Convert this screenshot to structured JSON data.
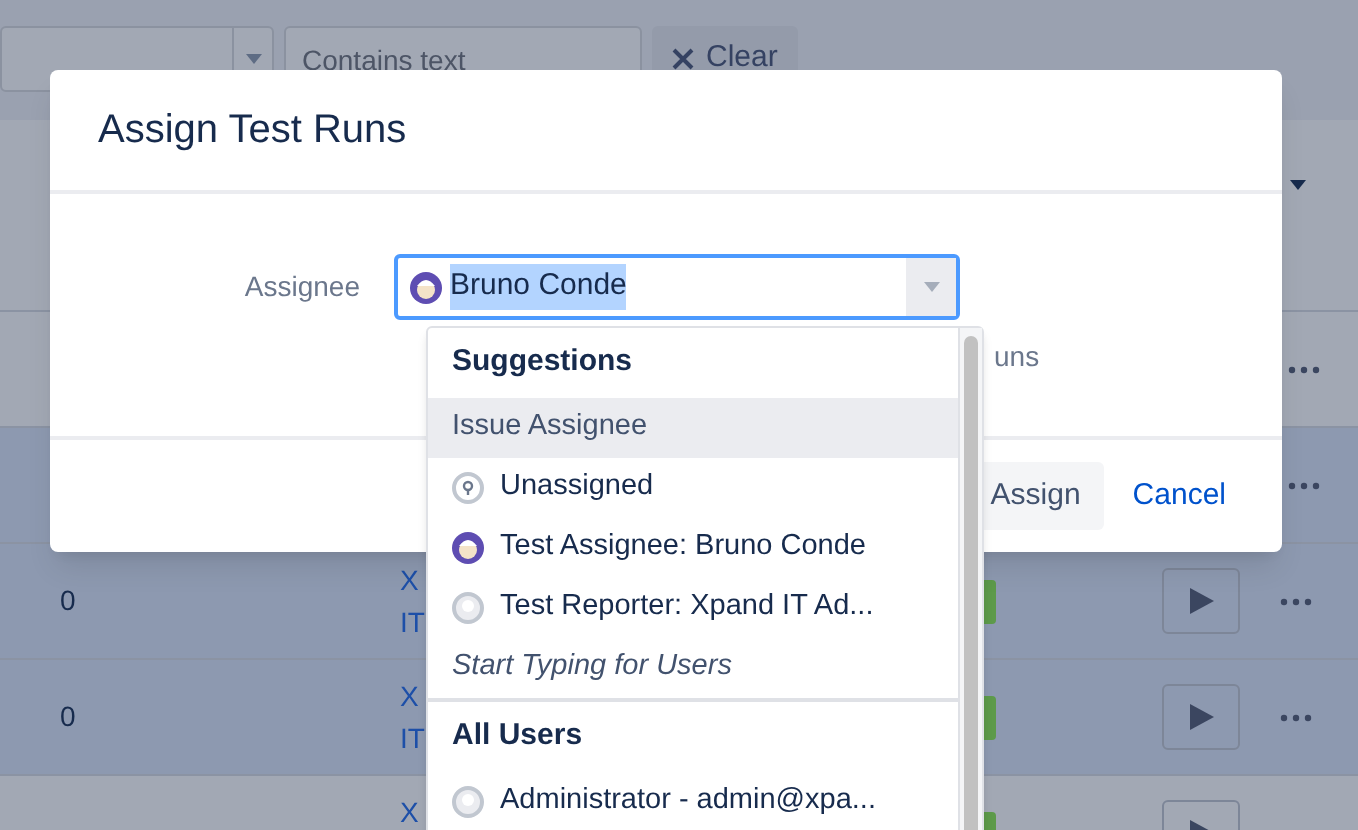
{
  "filter_bar": {
    "text_filter": {
      "placeholder": "Contains text"
    },
    "clear_button": "Clear"
  },
  "table": {
    "rows": [
      {
        "kind": "covered",
        "highlighted": false
      },
      {
        "kind": "covered",
        "highlighted": true
      },
      {
        "kind": "full",
        "highlighted": true,
        "column_1": "0",
        "column_2": [
          "X",
          "IT"
        ]
      },
      {
        "kind": "full",
        "highlighted": true,
        "column_1": "0",
        "column_2": [
          "X",
          "IT"
        ]
      },
      {
        "kind": "full",
        "highlighted": false,
        "column_2": [
          "X"
        ]
      }
    ]
  },
  "dialog": {
    "title": "Assign Test Runs",
    "field_label": "Assignee",
    "field_value": "Bruno Conde",
    "hint": "uns",
    "buttons": [
      {
        "label": "Assign",
        "kind": "primary"
      },
      {
        "label": "Cancel",
        "kind": "link"
      }
    ]
  },
  "dropdown": {
    "groups": [
      {
        "heading": "Suggestions",
        "items": [
          {
            "label": "Issue Assignee",
            "kind": "plain",
            "selected": true
          },
          {
            "label": "Unassigned",
            "kind": "unassigned",
            "selected": false
          },
          {
            "label": "Test Assignee: Bruno Conde",
            "kind": "user",
            "selected": false
          },
          {
            "label": "Test Reporter: Xpand IT Ad...",
            "kind": "default-user",
            "selected": false
          }
        ],
        "note": "Start Typing for Users"
      },
      {
        "heading": "All Users",
        "items": [
          {
            "label": "Administrator - admin@xpa...",
            "kind": "default-user",
            "selected": false
          }
        ]
      }
    ]
  }
}
